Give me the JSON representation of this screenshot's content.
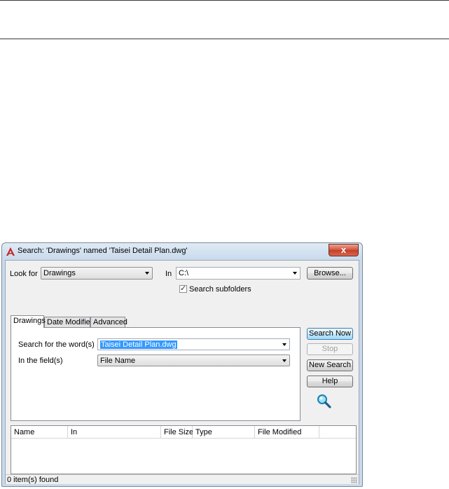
{
  "dialog": {
    "title": "Search: 'Drawings' named 'Taisei Detail Plan.dwg'",
    "close_glyph": "x",
    "look_for_label": "Look for",
    "look_for_value": "Drawings",
    "in_label": "In",
    "in_value": "C:\\",
    "browse_label": "Browse...",
    "search_subfolders_label": "Search subfolders",
    "search_subfolders_checked": true,
    "tabs": [
      {
        "label": "Drawings",
        "active": true
      },
      {
        "label": "Date Modified",
        "active": false
      },
      {
        "label": "Advanced",
        "active": false
      }
    ],
    "search_words_label": "Search for the word(s)",
    "search_words_value": "Taisei Detail Plan.dwg",
    "in_field_label": "In the field(s)",
    "in_field_value": "File Name",
    "buttons": {
      "search_now": "Search Now",
      "stop": "Stop",
      "new_search": "New Search",
      "help": "Help"
    },
    "search_icon": "magnifier-icon",
    "results_columns": [
      "Name",
      "In",
      "File Size",
      "Type",
      "File Modified"
    ],
    "status_text": "0 item(s) found"
  },
  "colors": {
    "accent_blue": "#3399ff",
    "close_red": "#c33f28"
  }
}
